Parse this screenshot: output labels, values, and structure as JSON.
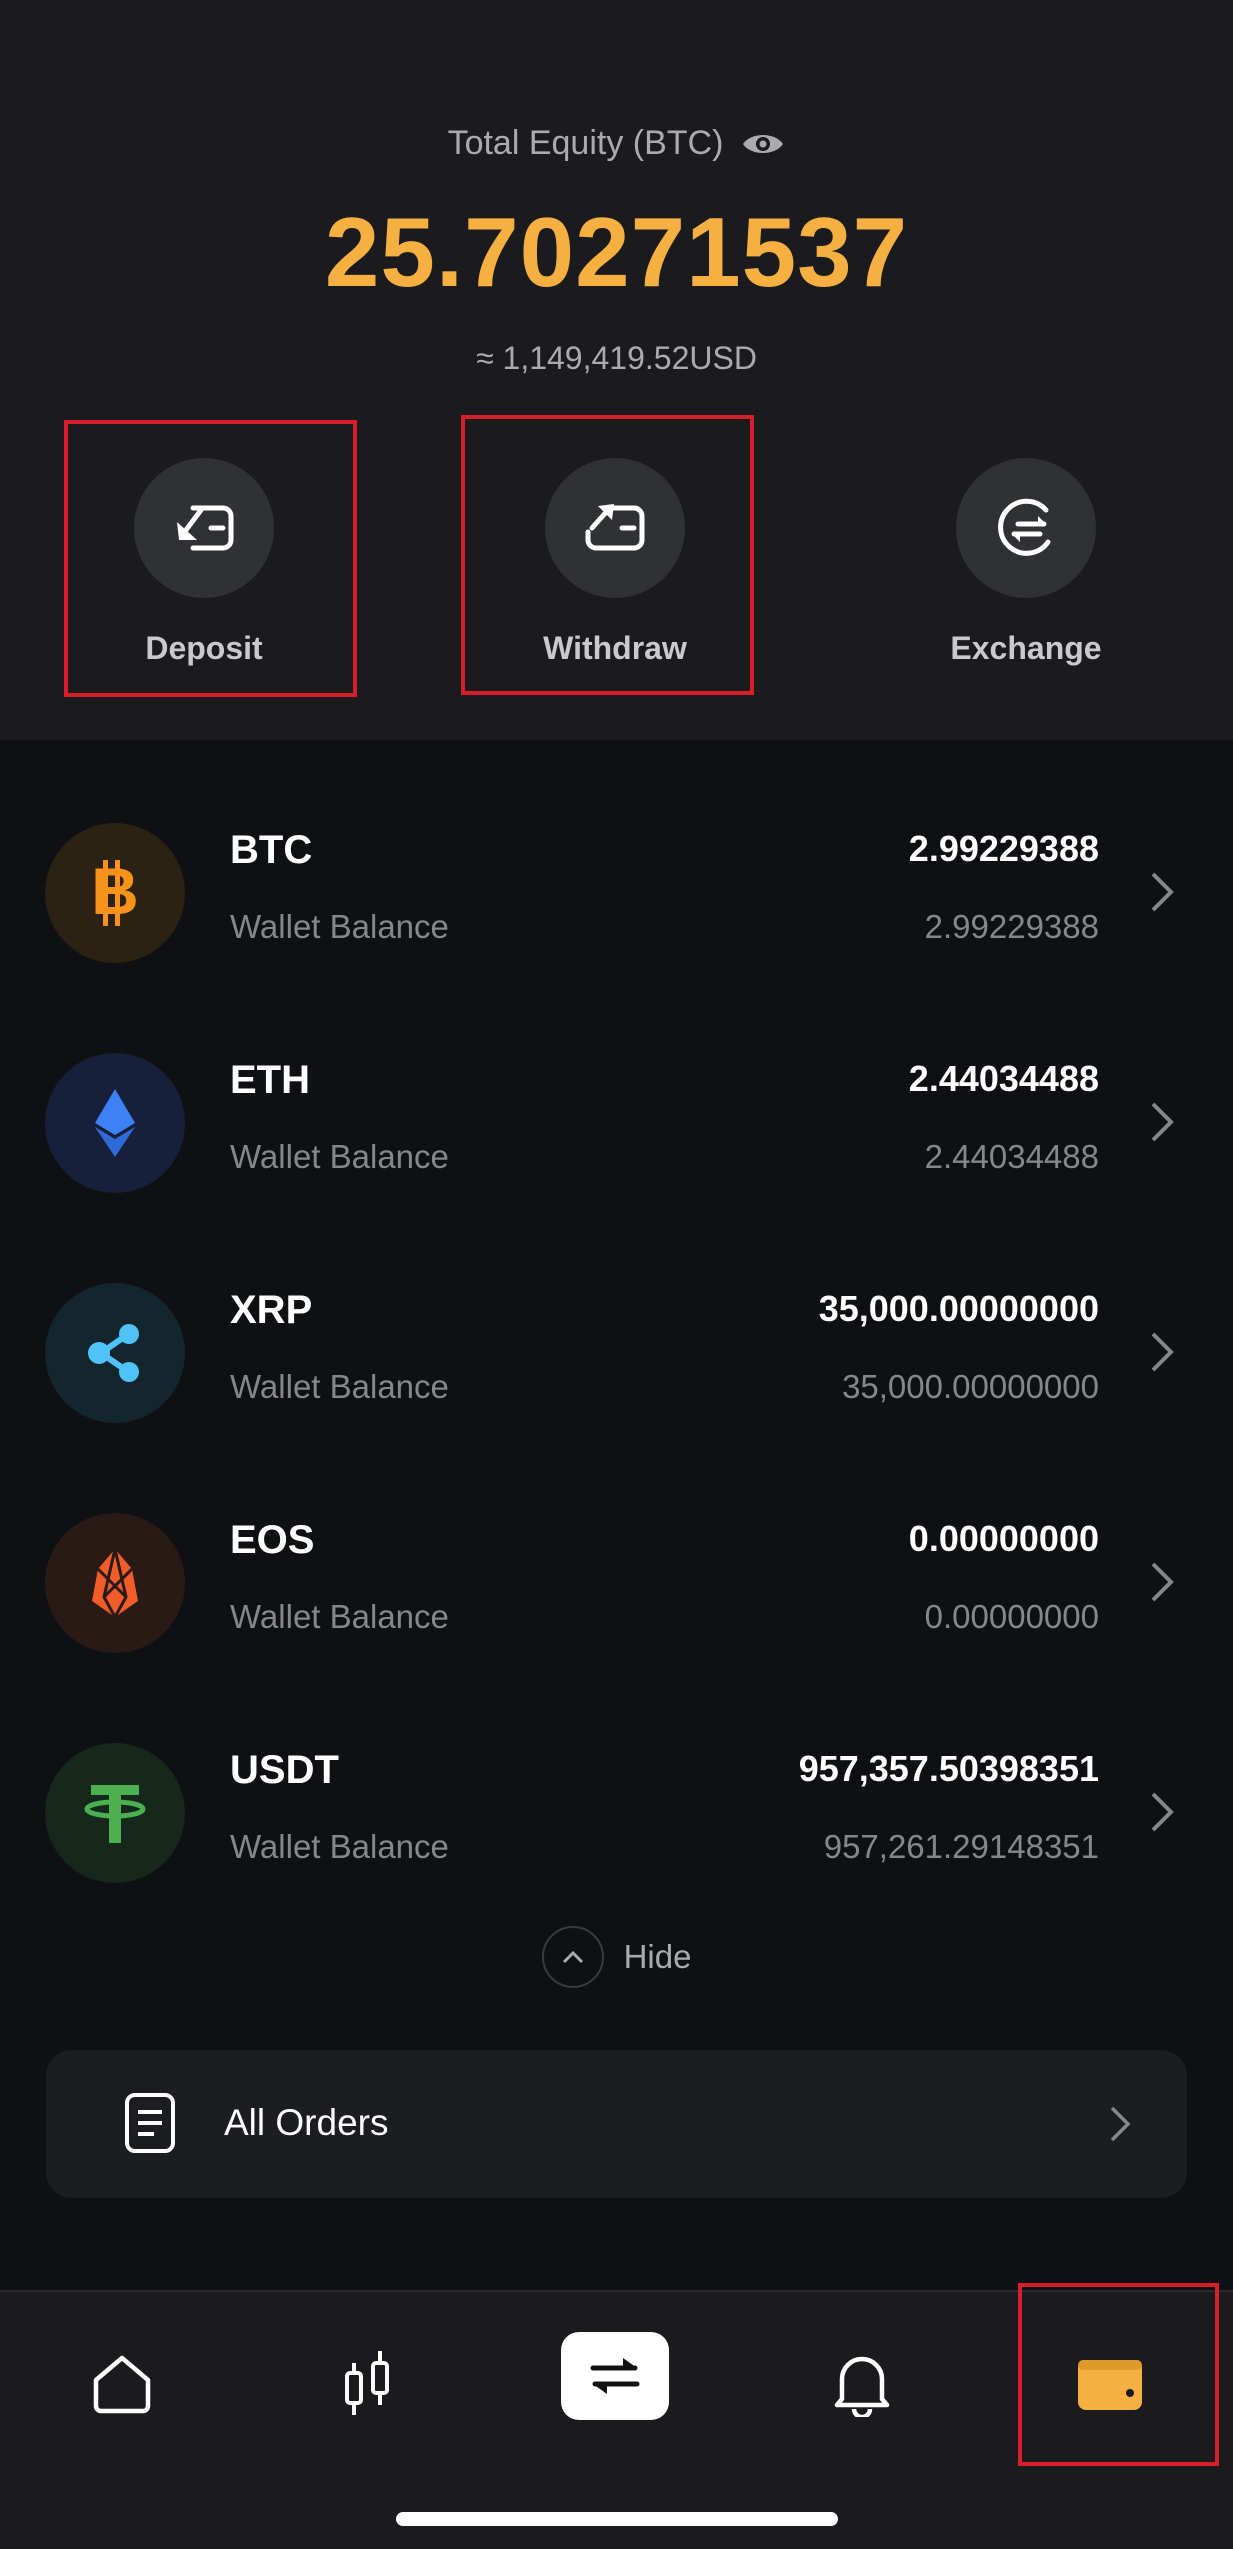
{
  "header": {
    "equity_label": "Total Equity (BTC)",
    "equity_value": "25.70271537",
    "equity_usd": "≈ 1,149,419.52USD"
  },
  "actions": [
    {
      "label": "Deposit",
      "icon": "deposit-icon"
    },
    {
      "label": "Withdraw",
      "icon": "withdraw-icon"
    },
    {
      "label": "Exchange",
      "icon": "exchange-icon"
    }
  ],
  "coins": [
    {
      "symbol": "BTC",
      "sub": "Wallet Balance",
      "value": "2.99229388",
      "balance": "2.99229388",
      "color": "#f7931a"
    },
    {
      "symbol": "ETH",
      "sub": "Wallet Balance",
      "value": "2.44034488",
      "balance": "2.44034488",
      "color": "#3c82f6"
    },
    {
      "symbol": "XRP",
      "sub": "Wallet Balance",
      "value": "35,000.00000000",
      "balance": "35,000.00000000",
      "color": "#4fc3f7"
    },
    {
      "symbol": "EOS",
      "sub": "Wallet Balance",
      "value": "0.00000000",
      "balance": "0.00000000",
      "color": "#f25c2a"
    },
    {
      "symbol": "USDT",
      "sub": "Wallet Balance",
      "value": "957,357.50398351",
      "balance": "957,261.29148351",
      "color": "#4caf50"
    }
  ],
  "hide_label": "Hide",
  "orders_label": "All Orders",
  "colors": {
    "accent": "#f5b041",
    "highlight": "#d81e2a",
    "background": "#0f1013",
    "panel": "#1b1b1d"
  },
  "tabs": [
    {
      "icon": "home-icon"
    },
    {
      "icon": "candlestick-icon"
    },
    {
      "icon": "swap-icon"
    },
    {
      "icon": "bell-icon"
    },
    {
      "icon": "wallet-icon"
    }
  ]
}
